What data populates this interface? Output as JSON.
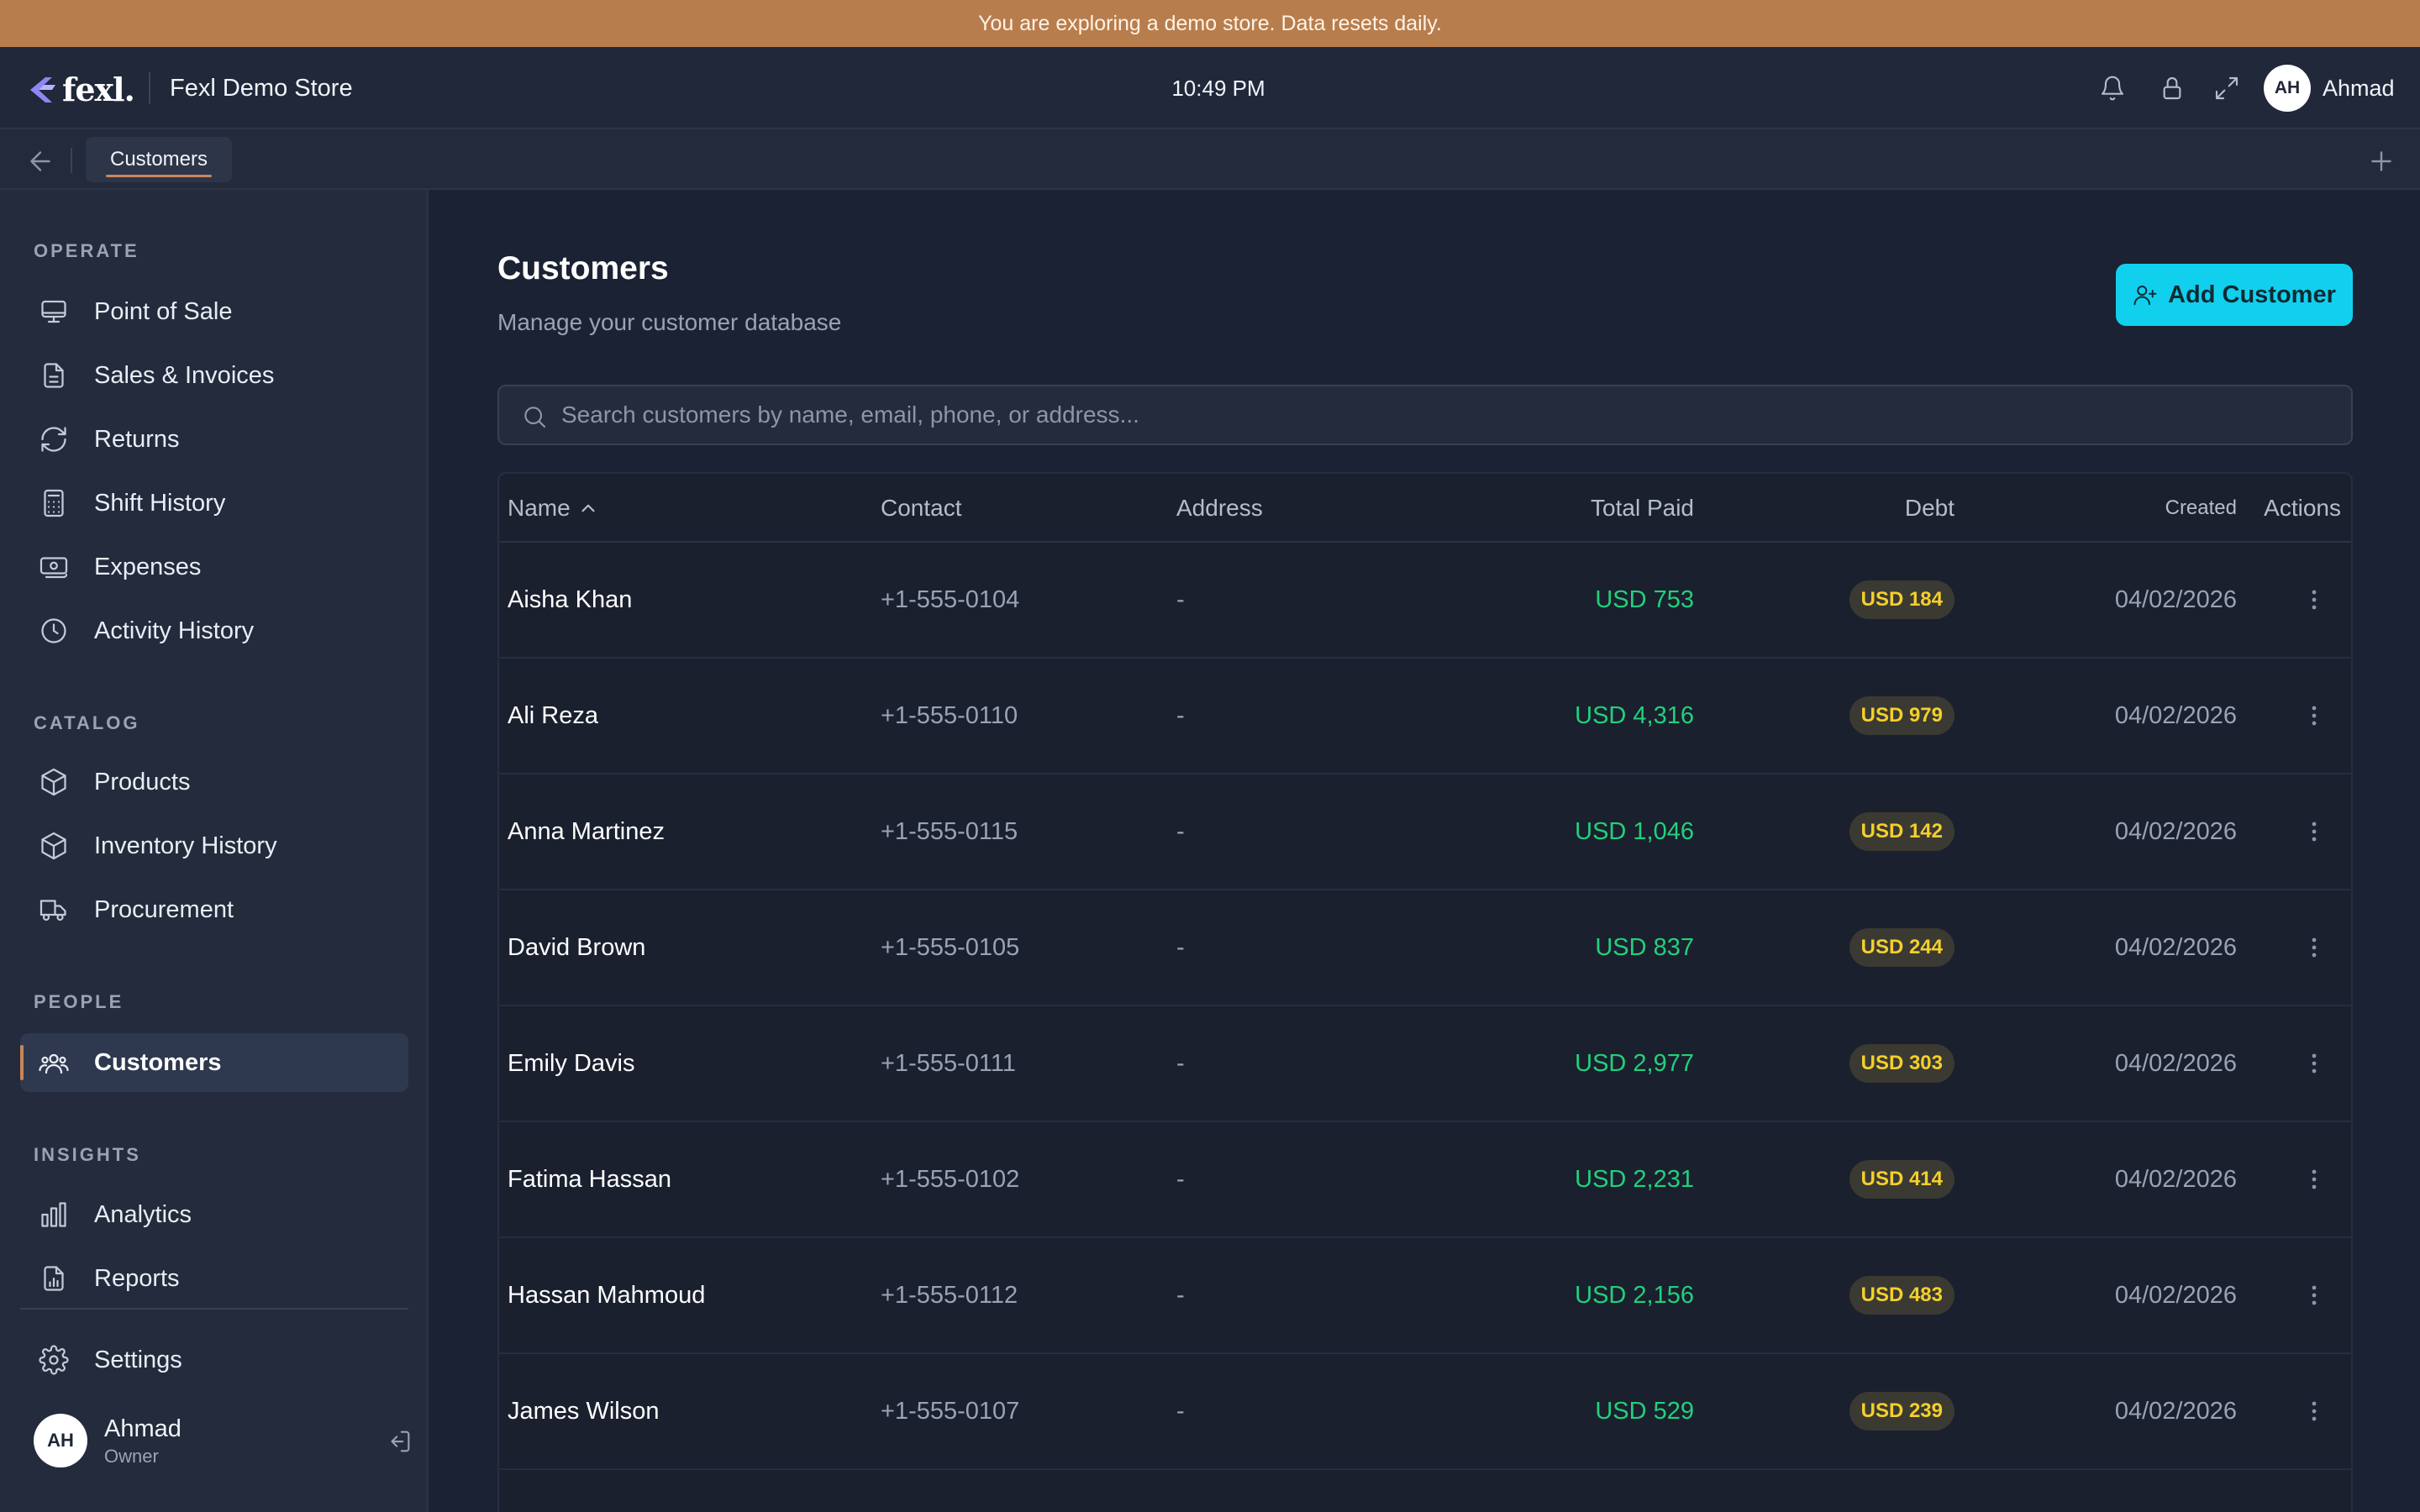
{
  "banner": {
    "text": "You are exploring a demo store. Data resets daily."
  },
  "header": {
    "logo_text": "fexl.",
    "store_name": "Fexl Demo Store",
    "time": "10:49 PM",
    "user_initials": "AH",
    "user_name": "Ahmad",
    "icons": [
      "bell-icon",
      "lock-icon",
      "fullscreen-icon"
    ]
  },
  "tabs": {
    "active": "Customers"
  },
  "sidebar": {
    "sections": [
      {
        "label": "OPERATE",
        "items": [
          {
            "label": "Point of Sale",
            "icon": "monitor-icon"
          },
          {
            "label": "Sales & Invoices",
            "icon": "file-icon"
          },
          {
            "label": "Returns",
            "icon": "refresh-icon"
          },
          {
            "label": "Shift History",
            "icon": "calculator-icon"
          },
          {
            "label": "Expenses",
            "icon": "banknote-icon"
          },
          {
            "label": "Activity History",
            "icon": "clock-icon"
          }
        ]
      },
      {
        "label": "CATALOG",
        "items": [
          {
            "label": "Products",
            "icon": "box-icon"
          },
          {
            "label": "Inventory History",
            "icon": "box-icon"
          },
          {
            "label": "Procurement",
            "icon": "truck-icon"
          }
        ]
      },
      {
        "label": "PEOPLE",
        "items": [
          {
            "label": "Customers",
            "icon": "users-icon",
            "active": true
          }
        ]
      },
      {
        "label": "INSIGHTS",
        "items": [
          {
            "label": "Analytics",
            "icon": "bar-chart-icon"
          },
          {
            "label": "Reports",
            "icon": "report-icon"
          }
        ]
      }
    ],
    "settings_label": "Settings",
    "user": {
      "initials": "AH",
      "name": "Ahmad",
      "role": "Owner"
    }
  },
  "main": {
    "title": "Customers",
    "subtitle": "Manage your customer database",
    "add_button": "Add Customer",
    "search_placeholder": "Search customers by name, email, phone, or address...",
    "columns": {
      "name": "Name",
      "contact": "Contact",
      "address": "Address",
      "total_paid": "Total Paid",
      "debt": "Debt",
      "created": "Created",
      "actions": "Actions"
    },
    "rows": [
      {
        "name": "Aisha Khan",
        "contact": "+1-555-0104",
        "address": "-",
        "total_paid": "USD 753",
        "debt": "USD 184",
        "created": "04/02/2026"
      },
      {
        "name": "Ali Reza",
        "contact": "+1-555-0110",
        "address": "-",
        "total_paid": "USD 4,316",
        "debt": "USD 979",
        "created": "04/02/2026"
      },
      {
        "name": "Anna Martinez",
        "contact": "+1-555-0115",
        "address": "-",
        "total_paid": "USD 1,046",
        "debt": "USD 142",
        "created": "04/02/2026"
      },
      {
        "name": "David Brown",
        "contact": "+1-555-0105",
        "address": "-",
        "total_paid": "USD 837",
        "debt": "USD 244",
        "created": "04/02/2026"
      },
      {
        "name": "Emily Davis",
        "contact": "+1-555-0111",
        "address": "-",
        "total_paid": "USD 2,977",
        "debt": "USD 303",
        "created": "04/02/2026"
      },
      {
        "name": "Fatima Hassan",
        "contact": "+1-555-0102",
        "address": "-",
        "total_paid": "USD 2,231",
        "debt": "USD 414",
        "created": "04/02/2026"
      },
      {
        "name": "Hassan Mahmoud",
        "contact": "+1-555-0112",
        "address": "-",
        "total_paid": "USD 2,156",
        "debt": "USD 483",
        "created": "04/02/2026"
      },
      {
        "name": "James Wilson",
        "contact": "+1-555-0107",
        "address": "-",
        "total_paid": "USD 529",
        "debt": "USD 239",
        "created": "04/02/2026"
      }
    ]
  },
  "colors": {
    "accent": "#11d0ee",
    "banner": "#b87d4d",
    "paid": "#22d07b",
    "debt": "#f5cf2a",
    "active_indicator": "#c9865a"
  }
}
